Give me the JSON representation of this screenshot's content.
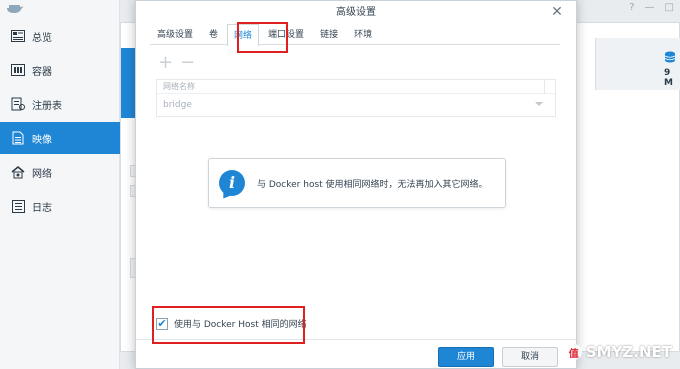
{
  "app": {
    "topbar_icons": [
      "question-icon",
      "minimize-icon",
      "maximize-icon"
    ]
  },
  "sidebar": {
    "items": [
      {
        "label": "总览",
        "icon": "overview-icon",
        "active": false
      },
      {
        "label": "容器",
        "icon": "container-icon",
        "active": false
      },
      {
        "label": "注册表",
        "icon": "registry-icon",
        "active": false
      },
      {
        "label": "映像",
        "icon": "image-icon",
        "active": true
      },
      {
        "label": "网络",
        "icon": "network-icon",
        "active": false
      },
      {
        "label": "日志",
        "icon": "log-icon",
        "active": false
      }
    ]
  },
  "background": {
    "right_stat": "9 M"
  },
  "dialog": {
    "title": "高级设置",
    "close_icon": "close-icon",
    "tabs": [
      {
        "label": "高级设置",
        "active": false
      },
      {
        "label": "卷",
        "active": false
      },
      {
        "label": "网络",
        "active": true
      },
      {
        "label": "端口设置",
        "active": false
      },
      {
        "label": "链接",
        "active": false
      },
      {
        "label": "环境",
        "active": false
      }
    ],
    "toolbar": {
      "add_label": "+",
      "remove_label": "−"
    },
    "network_table": {
      "header": "网络名称",
      "row_value": "bridge"
    },
    "info": {
      "icon_glyph": "i",
      "message": "与 Docker host 使用相同网络时，无法再加入其它网络。"
    },
    "use_host": {
      "checked": true,
      "label": "使用与 Docker Host 相同的网络"
    },
    "buttons": {
      "apply": "应用",
      "cancel": "取消"
    }
  },
  "watermark": {
    "text": "SMYZ.NET"
  },
  "colors": {
    "accent": "#1f86d6",
    "annotation_red": "#e02020"
  }
}
